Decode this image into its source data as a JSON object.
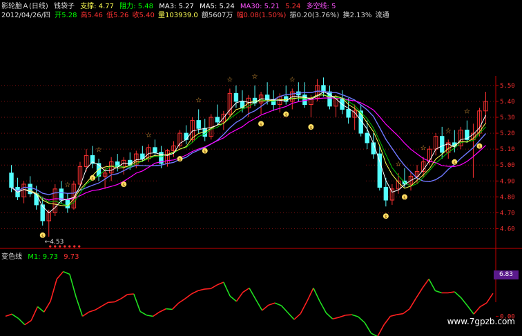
{
  "header": {
    "title": "影轮胎Ａ(日线)",
    "indicator_name": "钱袋子",
    "support_label": "支撑: 4.77",
    "resistance_label": "阻力: 5.48",
    "ma3": "MA3: 5.27",
    "ma5": "MA5: 5.24",
    "ma30": "MA30: 5.21",
    "ma_extra": "5.24",
    "multi_label": "多空线: 5",
    "date": "2012/04/26/四",
    "open": "开5.28",
    "high": "高5.46",
    "low": "低5.26",
    "close": "收5.40",
    "volume": "量103939.0",
    "amount": "额5607万",
    "change": "幅0.08(1.50%)",
    "amplitude": "振0.20(3.76%)",
    "turnover": "换2.13%",
    "float": "流通"
  },
  "indicator_panel": {
    "name": "变色线",
    "m1": "M1: 9.73",
    "m2": "9.73",
    "badge": "6.83"
  },
  "watermark": "www.7gpzb.com",
  "low_marker": "4.53",
  "colors": {
    "up": "#ff3232",
    "down": "#54ffff",
    "ma_white": "#ffffff",
    "ma_yellow": "#ffff54",
    "ma_green": "#00c800",
    "ma_purple": "#ff00ff",
    "ma_blue": "#6e78ff",
    "grid": "#801010",
    "axis": "#c80000"
  },
  "chart_data": [
    {
      "type": "candlestick",
      "y_ticks": [
        "5.50",
        "5.40",
        "5.30",
        "5.20",
        "5.10",
        "5.00",
        "4.90",
        "4.80",
        "4.70",
        "4.60"
      ],
      "ylim": [
        4.52,
        5.56
      ],
      "ohlc": [
        [
          4.95,
          5.0,
          4.83,
          4.86
        ],
        [
          4.86,
          4.92,
          4.78,
          4.8
        ],
        [
          4.8,
          4.9,
          4.76,
          4.88
        ],
        [
          4.88,
          4.93,
          4.8,
          4.82
        ],
        [
          4.82,
          4.87,
          4.72,
          4.75
        ],
        [
          4.75,
          4.8,
          4.62,
          4.65
        ],
        [
          4.65,
          4.72,
          4.55,
          4.7
        ],
        [
          4.7,
          4.88,
          4.68,
          4.85
        ],
        [
          4.85,
          4.9,
          4.76,
          4.78
        ],
        [
          4.78,
          4.82,
          4.7,
          4.73
        ],
        [
          4.73,
          4.9,
          4.72,
          4.88
        ],
        [
          4.88,
          5.02,
          4.86,
          4.99
        ],
        [
          4.99,
          5.1,
          4.96,
          5.06
        ],
        [
          5.06,
          5.12,
          4.98,
          5.01
        ],
        [
          5.01,
          5.04,
          4.9,
          4.93
        ],
        [
          4.93,
          4.98,
          4.85,
          4.95
        ],
        [
          4.95,
          5.05,
          4.9,
          5.02
        ],
        [
          5.02,
          5.07,
          4.96,
          4.99
        ],
        [
          4.99,
          5.05,
          4.94,
          5.03
        ],
        [
          5.03,
          5.08,
          4.97,
          5.0
        ],
        [
          5.0,
          5.09,
          4.98,
          5.07
        ],
        [
          5.07,
          5.12,
          5.02,
          5.04
        ],
        [
          5.04,
          5.13,
          5.02,
          5.11
        ],
        [
          5.11,
          5.16,
          5.06,
          5.08
        ],
        [
          5.08,
          5.12,
          4.98,
          5.01
        ],
        [
          5.01,
          5.1,
          4.99,
          5.09
        ],
        [
          5.09,
          5.15,
          5.05,
          5.12
        ],
        [
          5.12,
          5.22,
          5.1,
          5.2
        ],
        [
          5.2,
          5.25,
          5.13,
          5.16
        ],
        [
          5.16,
          5.3,
          5.14,
          5.28
        ],
        [
          5.28,
          5.35,
          5.2,
          5.23
        ],
        [
          5.23,
          5.29,
          5.15,
          5.18
        ],
        [
          5.18,
          5.32,
          5.16,
          5.3
        ],
        [
          5.3,
          5.38,
          5.25,
          5.27
        ],
        [
          5.27,
          5.34,
          5.22,
          5.32
        ],
        [
          5.32,
          5.48,
          5.3,
          5.45
        ],
        [
          5.45,
          5.5,
          5.36,
          5.4
        ],
        [
          5.4,
          5.47,
          5.33,
          5.36
        ],
        [
          5.36,
          5.44,
          5.3,
          5.42
        ],
        [
          5.42,
          5.5,
          5.37,
          5.39
        ],
        [
          5.39,
          5.46,
          5.32,
          5.44
        ],
        [
          5.44,
          5.52,
          5.38,
          5.41
        ],
        [
          5.41,
          5.47,
          5.34,
          5.38
        ],
        [
          5.38,
          5.45,
          5.33,
          5.43
        ],
        [
          5.43,
          5.5,
          5.38,
          5.4
        ],
        [
          5.4,
          5.48,
          5.35,
          5.46
        ],
        [
          5.46,
          5.52,
          5.4,
          5.44
        ],
        [
          5.44,
          5.52,
          5.36,
          5.38
        ],
        [
          5.38,
          5.44,
          5.3,
          5.42
        ],
        [
          5.42,
          5.54,
          5.4,
          5.5
        ],
        [
          5.5,
          5.55,
          5.43,
          5.46
        ],
        [
          5.46,
          5.5,
          5.35,
          5.37
        ],
        [
          5.37,
          5.44,
          5.3,
          5.42
        ],
        [
          5.42,
          5.47,
          5.32,
          5.35
        ],
        [
          5.35,
          5.42,
          5.26,
          5.3
        ],
        [
          5.3,
          5.38,
          5.22,
          5.34
        ],
        [
          5.34,
          5.38,
          5.18,
          5.2
        ],
        [
          5.2,
          5.28,
          5.1,
          5.14
        ],
        [
          5.14,
          5.2,
          5.04,
          5.07
        ],
        [
          5.07,
          5.12,
          4.84,
          4.86
        ],
        [
          4.86,
          4.92,
          4.74,
          4.78
        ],
        [
          4.78,
          4.88,
          4.75,
          4.85
        ],
        [
          4.85,
          4.95,
          4.82,
          4.9
        ],
        [
          4.9,
          4.98,
          4.86,
          4.88
        ],
        [
          4.88,
          4.96,
          4.84,
          4.93
        ],
        [
          4.93,
          5.0,
          4.88,
          4.96
        ],
        [
          4.96,
          5.05,
          4.92,
          5.02
        ],
        [
          5.02,
          5.12,
          5.0,
          5.1
        ],
        [
          5.1,
          5.2,
          5.06,
          5.18
        ],
        [
          5.18,
          5.24,
          5.04,
          5.08
        ],
        [
          5.08,
          5.16,
          5.04,
          5.14
        ],
        [
          5.14,
          5.22,
          5.08,
          5.12
        ],
        [
          5.12,
          5.24,
          5.1,
          5.22
        ],
        [
          5.22,
          5.28,
          5.14,
          5.16
        ],
        [
          5.16,
          5.26,
          4.92,
          5.2
        ],
        [
          5.2,
          5.36,
          5.18,
          5.34
        ],
        [
          5.34,
          5.46,
          5.26,
          5.4
        ]
      ]
    },
    {
      "type": "line",
      "name": "变色线",
      "ylim": [
        -2.8,
        11.2
      ],
      "values": [
        0.0,
        0.4,
        -0.4,
        -1.6,
        -0.8,
        1.8,
        0.8,
        2.8,
        7.0,
        8.4,
        7.9,
        3.6,
        0.0,
        0.8,
        1.2,
        1.9,
        2.6,
        2.7,
        3.3,
        4.1,
        4.2,
        0.9,
        0.2,
        0.0,
        0.8,
        1.4,
        1.3,
        2.5,
        3.3,
        4.2,
        4.8,
        5.1,
        5.2,
        5.9,
        6.4,
        3.8,
        2.8,
        4.5,
        5.3,
        3.2,
        1.1,
        2.1,
        2.5,
        2.0,
        0.7,
        -0.6,
        0.5,
        2.8,
        5.3,
        2.8,
        0.6,
        -0.5,
        -0.2,
        0.2,
        0.3,
        -0.1,
        -1.2,
        -3.2,
        -3.8,
        -1.6,
        0.0,
        0.3,
        0.5,
        1.4,
        3.4,
        5.3,
        7.0,
        4.8,
        4.4,
        4.4,
        4.6,
        3.5,
        2.0,
        0.4,
        1.8,
        2.5,
        4.3
      ]
    }
  ]
}
